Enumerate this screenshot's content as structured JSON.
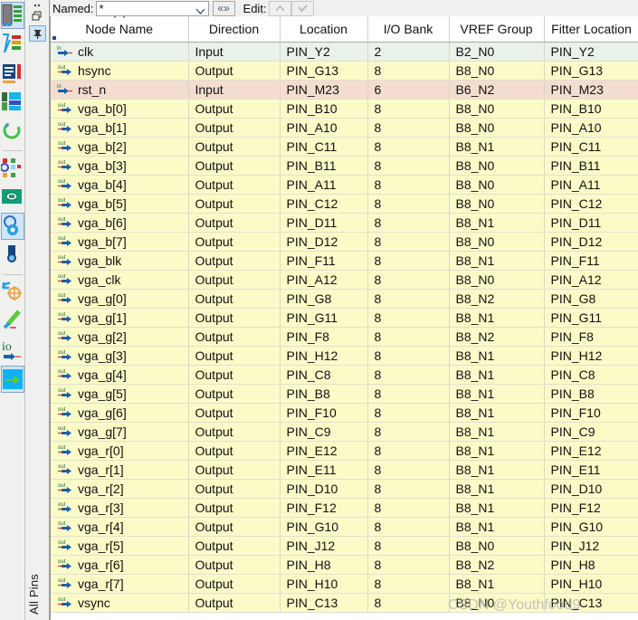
{
  "toolbar": {
    "named_label": "Named:",
    "named_value": "*",
    "filter_button": "«»",
    "edit_label": "Edit:",
    "edit_up_icon": "chevron-up-icon",
    "edit_check_icon": "check-icon"
  },
  "side_tab": {
    "label": "All Pins"
  },
  "table": {
    "columns": [
      "Node Name",
      "Direction",
      "Location",
      "I/O Bank",
      "VREF Group",
      "Fitter Location",
      ""
    ],
    "sort_column": "Node Name",
    "rows": [
      {
        "dir_icon": "in",
        "name": "clk",
        "direction": "Input",
        "location": "PIN_Y2",
        "bank": "2",
        "vref": "B2_N0",
        "fitter": "PIN_Y2",
        "extra": "2",
        "style": "in"
      },
      {
        "dir_icon": "out",
        "name": "hsync",
        "direction": "Output",
        "location": "PIN_G13",
        "bank": "8",
        "vref": "B8_N0",
        "fitter": "PIN_G13",
        "extra": "8",
        "style": "out"
      },
      {
        "dir_icon": "in",
        "name": "rst_n",
        "direction": "Input",
        "location": "PIN_M23",
        "bank": "6",
        "vref": "B6_N2",
        "fitter": "PIN_M23",
        "extra": "6",
        "style": "hi"
      },
      {
        "dir_icon": "out",
        "name": "vga_b[0]",
        "direction": "Output",
        "location": "PIN_B10",
        "bank": "8",
        "vref": "B8_N0",
        "fitter": "PIN_B10",
        "extra": "8",
        "style": "out"
      },
      {
        "dir_icon": "out",
        "name": "vga_b[1]",
        "direction": "Output",
        "location": "PIN_A10",
        "bank": "8",
        "vref": "B8_N0",
        "fitter": "PIN_A10",
        "extra": "8",
        "style": "out"
      },
      {
        "dir_icon": "out",
        "name": "vga_b[2]",
        "direction": "Output",
        "location": "PIN_C11",
        "bank": "8",
        "vref": "B8_N1",
        "fitter": "PIN_C11",
        "extra": "8",
        "style": "out"
      },
      {
        "dir_icon": "out",
        "name": "vga_b[3]",
        "direction": "Output",
        "location": "PIN_B11",
        "bank": "8",
        "vref": "B8_N0",
        "fitter": "PIN_B11",
        "extra": "8",
        "style": "out"
      },
      {
        "dir_icon": "out",
        "name": "vga_b[4]",
        "direction": "Output",
        "location": "PIN_A11",
        "bank": "8",
        "vref": "B8_N0",
        "fitter": "PIN_A11",
        "extra": "8",
        "style": "out"
      },
      {
        "dir_icon": "out",
        "name": "vga_b[5]",
        "direction": "Output",
        "location": "PIN_C12",
        "bank": "8",
        "vref": "B8_N0",
        "fitter": "PIN_C12",
        "extra": "8",
        "style": "out"
      },
      {
        "dir_icon": "out",
        "name": "vga_b[6]",
        "direction": "Output",
        "location": "PIN_D11",
        "bank": "8",
        "vref": "B8_N1",
        "fitter": "PIN_D11",
        "extra": "8",
        "style": "out"
      },
      {
        "dir_icon": "out",
        "name": "vga_b[7]",
        "direction": "Output",
        "location": "PIN_D12",
        "bank": "8",
        "vref": "B8_N0",
        "fitter": "PIN_D12",
        "extra": "8",
        "style": "out"
      },
      {
        "dir_icon": "out",
        "name": "vga_blk",
        "direction": "Output",
        "location": "PIN_F11",
        "bank": "8",
        "vref": "B8_N1",
        "fitter": "PIN_F11",
        "extra": "8",
        "style": "out"
      },
      {
        "dir_icon": "out",
        "name": "vga_clk",
        "direction": "Output",
        "location": "PIN_A12",
        "bank": "8",
        "vref": "B8_N0",
        "fitter": "PIN_A12",
        "extra": "8",
        "style": "out"
      },
      {
        "dir_icon": "out",
        "name": "vga_g[0]",
        "direction": "Output",
        "location": "PIN_G8",
        "bank": "8",
        "vref": "B8_N2",
        "fitter": "PIN_G8",
        "extra": "8",
        "style": "out"
      },
      {
        "dir_icon": "out",
        "name": "vga_g[1]",
        "direction": "Output",
        "location": "PIN_G11",
        "bank": "8",
        "vref": "B8_N1",
        "fitter": "PIN_G11",
        "extra": "8",
        "style": "out"
      },
      {
        "dir_icon": "out",
        "name": "vga_g[2]",
        "direction": "Output",
        "location": "PIN_F8",
        "bank": "8",
        "vref": "B8_N2",
        "fitter": "PIN_F8",
        "extra": "8",
        "style": "out"
      },
      {
        "dir_icon": "out",
        "name": "vga_g[3]",
        "direction": "Output",
        "location": "PIN_H12",
        "bank": "8",
        "vref": "B8_N1",
        "fitter": "PIN_H12",
        "extra": "8",
        "style": "out"
      },
      {
        "dir_icon": "out",
        "name": "vga_g[4]",
        "direction": "Output",
        "location": "PIN_C8",
        "bank": "8",
        "vref": "B8_N1",
        "fitter": "PIN_C8",
        "extra": "8",
        "style": "out"
      },
      {
        "dir_icon": "out",
        "name": "vga_g[5]",
        "direction": "Output",
        "location": "PIN_B8",
        "bank": "8",
        "vref": "B8_N1",
        "fitter": "PIN_B8",
        "extra": "8",
        "style": "out"
      },
      {
        "dir_icon": "out",
        "name": "vga_g[6]",
        "direction": "Output",
        "location": "PIN_F10",
        "bank": "8",
        "vref": "B8_N1",
        "fitter": "PIN_F10",
        "extra": "8",
        "style": "out"
      },
      {
        "dir_icon": "out",
        "name": "vga_g[7]",
        "direction": "Output",
        "location": "PIN_C9",
        "bank": "8",
        "vref": "B8_N1",
        "fitter": "PIN_C9",
        "extra": "8",
        "style": "out"
      },
      {
        "dir_icon": "out",
        "name": "vga_r[0]",
        "direction": "Output",
        "location": "PIN_E12",
        "bank": "8",
        "vref": "B8_N1",
        "fitter": "PIN_E12",
        "extra": "8",
        "style": "out"
      },
      {
        "dir_icon": "out",
        "name": "vga_r[1]",
        "direction": "Output",
        "location": "PIN_E11",
        "bank": "8",
        "vref": "B8_N1",
        "fitter": "PIN_E11",
        "extra": "8",
        "style": "out"
      },
      {
        "dir_icon": "out",
        "name": "vga_r[2]",
        "direction": "Output",
        "location": "PIN_D10",
        "bank": "8",
        "vref": "B8_N1",
        "fitter": "PIN_D10",
        "extra": "8",
        "style": "out"
      },
      {
        "dir_icon": "out",
        "name": "vga_r[3]",
        "direction": "Output",
        "location": "PIN_F12",
        "bank": "8",
        "vref": "B8_N1",
        "fitter": "PIN_F12",
        "extra": "8",
        "style": "out"
      },
      {
        "dir_icon": "out",
        "name": "vga_r[4]",
        "direction": "Output",
        "location": "PIN_G10",
        "bank": "8",
        "vref": "B8_N1",
        "fitter": "PIN_G10",
        "extra": "8",
        "style": "out"
      },
      {
        "dir_icon": "out",
        "name": "vga_r[5]",
        "direction": "Output",
        "location": "PIN_J12",
        "bank": "8",
        "vref": "B8_N0",
        "fitter": "PIN_J12",
        "extra": "8",
        "style": "out"
      },
      {
        "dir_icon": "out",
        "name": "vga_r[6]",
        "direction": "Output",
        "location": "PIN_H8",
        "bank": "8",
        "vref": "B8_N2",
        "fitter": "PIN_H8",
        "extra": "8",
        "style": "out"
      },
      {
        "dir_icon": "out",
        "name": "vga_r[7]",
        "direction": "Output",
        "location": "PIN_H10",
        "bank": "8",
        "vref": "B8_N1",
        "fitter": "PIN_H10",
        "extra": "8",
        "style": "out"
      },
      {
        "dir_icon": "out",
        "name": "vsync",
        "direction": "Output",
        "location": "PIN_C13",
        "bank": "8",
        "vref": "B8_N0",
        "fitter": "PIN_C13",
        "extra": "8",
        "style": "out"
      }
    ]
  },
  "watermark": {
    "text": "CSDN @Youthfood9"
  },
  "colors": {
    "row_input": "#eaf2ea",
    "row_output": "#fbfbc8",
    "row_highlight": "#f3ddcf",
    "chrome": "#f0f0ef"
  }
}
